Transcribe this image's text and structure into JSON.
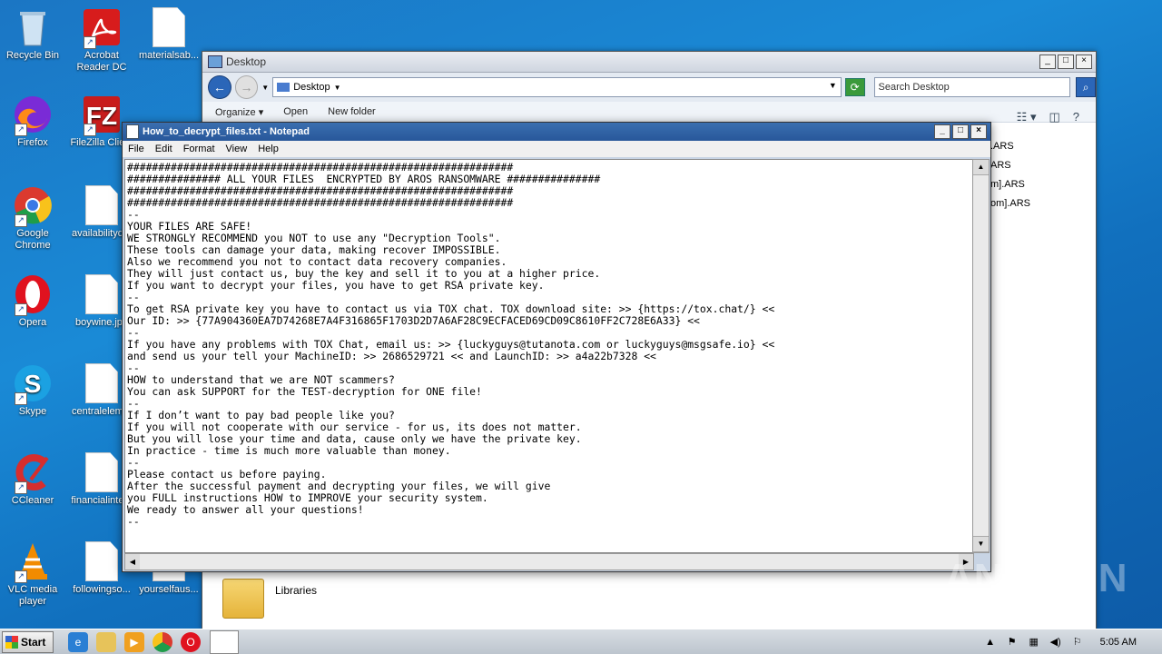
{
  "desktop": {
    "icons_col1": [
      {
        "label": "Recycle Bin",
        "icon": "recycle-bin-icon"
      },
      {
        "label": "Firefox",
        "icon": "firefox-icon"
      },
      {
        "label": "Google Chrome",
        "icon": "chrome-icon"
      },
      {
        "label": "Opera",
        "icon": "opera-icon"
      },
      {
        "label": "Skype",
        "icon": "skype-icon"
      },
      {
        "label": "CCleaner",
        "icon": "ccleaner-icon"
      },
      {
        "label": "VLC media player",
        "icon": "vlc-icon"
      }
    ],
    "icons_col2": [
      {
        "label": "Acrobat Reader DC",
        "icon": "acrobat-icon"
      },
      {
        "label": "FileZilla Client",
        "icon": "filezilla-icon"
      },
      {
        "label": "availabilityd...",
        "icon": "file-icon"
      },
      {
        "label": "boywine.jpg",
        "icon": "file-icon"
      },
      {
        "label": "centralelem...",
        "icon": "file-icon"
      },
      {
        "label": "financialinte...",
        "icon": "file-icon"
      },
      {
        "label": "followingso...",
        "icon": "file-icon"
      }
    ],
    "icons_col3": [
      {
        "label": "materialsab...",
        "icon": "file-icon"
      },
      {
        "label": "yourselfaus...",
        "icon": "file-icon"
      }
    ]
  },
  "explorer": {
    "title": "Desktop",
    "address": "Desktop",
    "search_placeholder": "Search Desktop",
    "commands": {
      "organize": "Organize",
      "open": "Open",
      "new_folder": "New folder"
    },
    "partial_files": [
      ".ARS",
      "ARS",
      "m].ARS",
      "om].ARS"
    ],
    "libraries_label": "Libraries"
  },
  "notepad": {
    "title": "How_to_decrypt_files.txt - Notepad",
    "menu": [
      "File",
      "Edit",
      "Format",
      "View",
      "Help"
    ],
    "content": "##############################################################\n############### ALL YOUR FILES  ENCRYPTED BY AROS RANSOMWARE ###############\n##############################################################\n##############################################################\n--\nYOUR FILES ARE SAFE!\nWE STRONGLY RECOMMEND you NOT to use any \"Decryption Tools\".\nThese tools can damage your data, making recover IMPOSSIBLE.\nAlso we recommend you not to contact data recovery companies.\nThey will just contact us, buy the key and sell it to you at a higher price.\nIf you want to decrypt your files, you have to get RSA private key.\n--\nTo get RSA private key you have to contact us via TOX chat. TOX download site: >> {https://tox.chat/} <<\nOur ID: >> {77A904360EA7D74268E7A4F316865F1703D2D7A6AF28C9ECFACED69CD09C8610FF2C728E6A33} <<\n--\nIf you have any problems with TOX Chat, email us: >> {luckyguys@tutanota.com or luckyguys@msgsafe.io} <<\nand send us your tell your MachineID: >> 2686529721 << and LaunchID: >> a4a22b7328 <<\n--\nHOW to understand that we are NOT scammers?\nYou can ask SUPPORT for the TEST-decryption for ONE file!\n--\nIf I don’t want to pay bad people like you?\nIf you will not cooperate with our service - for us, its does not matter.\nBut you will lose your time and data, cause only we have the private key.\nIn practice - time is much more valuable than money.\n--\nPlease contact us before paying.\nAfter the successful payment and decrypting your files, we will give\nyou FULL instructions HOW to IMPROVE your security system.\nWe ready to answer all your questions!\n--"
  },
  "watermark": "ANY.RUN",
  "taskbar": {
    "start_label": "Start",
    "clock": "5:05 AM"
  }
}
